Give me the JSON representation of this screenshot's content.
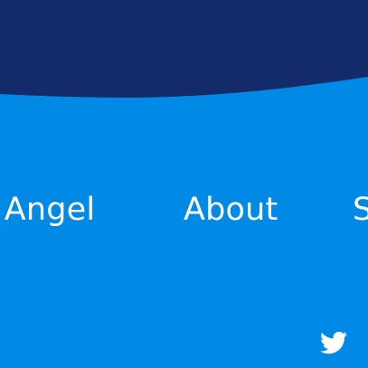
{
  "colors": {
    "background": "#008ae6",
    "top_band": "#132b6b",
    "text": "#ffffff"
  },
  "nav": {
    "items": [
      {
        "label": "n Angel"
      },
      {
        "label": "About"
      },
      {
        "label": "S"
      }
    ]
  },
  "social": {
    "icon": "twitter-icon"
  }
}
